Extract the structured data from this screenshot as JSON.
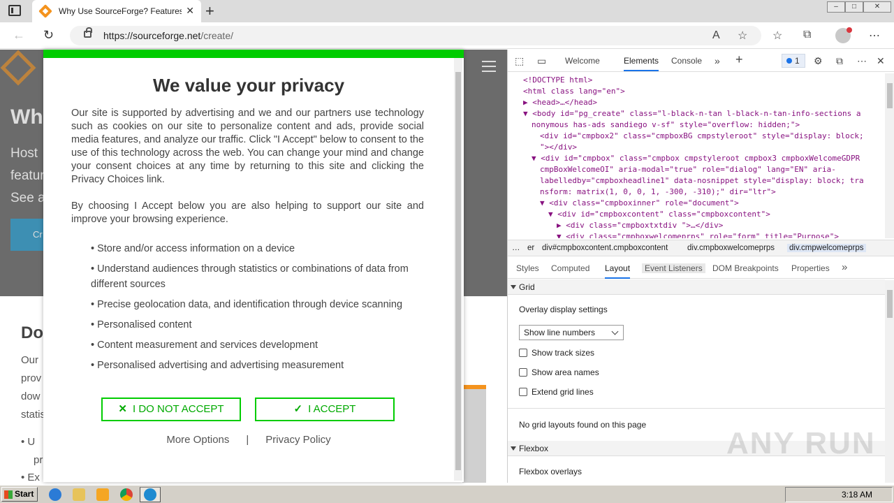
{
  "browser": {
    "tab_title": "Why Use SourceForge? Features a",
    "tab_close": "✕",
    "new_tab": "+",
    "url_host": "https://sourceforge.net",
    "url_path": "/create/"
  },
  "page_behind": {
    "hero_heading": "Wh",
    "hero_lines": [
      "Host",
      "featur",
      "See a"
    ],
    "hero_button": "Cr",
    "doc_heading": "Do",
    "doc_lines": [
      "Our",
      "prov",
      "dow",
      "statis"
    ],
    "doc_bullets": [
      "U",
      "pr",
      "Ex"
    ]
  },
  "consent": {
    "title": "We value your privacy",
    "intro": "Our site is supported by advertising and we and our partners use technology such as cookies on our site to personalize content and ads, provide social media features, and analyze our traffic. Click \"I Accept\" below to consent to the use of this technology across the web. You can change your mind and change your consent choices at any time by returning to this site and clicking the Privacy Choices link.",
    "choosing": "By choosing I Accept below you are also helping to support our site and improve your browsing experience.",
    "purposes": [
      "• Store and/or access information on a device",
      "• Understand audiences through statistics or combinations of data from different sources",
      "• Precise geolocation data, and identification through device scanning",
      "• Personalised content",
      "• Content measurement and services development",
      "• Personalised advertising and advertising measurement"
    ],
    "reject_label": "I DO NOT ACCEPT",
    "accept_label": "I ACCEPT",
    "more_options": "More Options",
    "separator": "|",
    "privacy_policy": "Privacy Policy"
  },
  "devtools": {
    "tabs": [
      "Welcome",
      "Elements",
      "Console"
    ],
    "active_tab": "Elements",
    "issues_count": "1",
    "dom_lines": [
      {
        "indent": 0,
        "arrow": "",
        "html": "<!DOCTYPE html>"
      },
      {
        "indent": 0,
        "arrow": "",
        "html": "<html class lang=\"en\">"
      },
      {
        "indent": 1,
        "arrow": "▶",
        "html": "<head>…</head>"
      },
      {
        "indent": 1,
        "arrow": "▼",
        "html": "<body id=\"pg_create\" class=\"l-black-n-tan l-black-n-tan-info-sections  a"
      },
      {
        "indent": 1,
        "arrow": "",
        "html": "nonymous has-ads sandiego v-sf\" style=\"overflow: hidden;\">"
      },
      {
        "indent": 2,
        "arrow": "",
        "html": "<div id=\"cmpbox2\" class=\"cmpboxBG cmpstyleroot\" style=\"display: block;"
      },
      {
        "indent": 2,
        "arrow": "",
        "html": "\"></div>"
      },
      {
        "indent": 2,
        "arrow": "▼",
        "html": "<div id=\"cmpbox\" class=\"cmpbox cmpstyleroot cmpbox3 cmpboxWelcomeGDPR"
      },
      {
        "indent": 2,
        "arrow": "",
        "html": "cmpBoxWelcomeOI\" aria-modal=\"true\" role=\"dialog\" lang=\"EN\" aria-"
      },
      {
        "indent": 2,
        "arrow": "",
        "html": "labelledby=\"cmpboxheadline1\" data-nosnippet style=\"display: block; tra"
      },
      {
        "indent": 2,
        "arrow": "",
        "html": "nsform: matrix(1, 0, 0, 1, -300, -310);\" dir=\"ltr\">"
      },
      {
        "indent": 3,
        "arrow": "▼",
        "html": "<div class=\"cmpboxinner\" role=\"document\">"
      },
      {
        "indent": 4,
        "arrow": "▼",
        "html": "<div id=\"cmpboxcontent\" class=\"cmpboxcontent\">"
      },
      {
        "indent": 5,
        "arrow": "▶",
        "html": "<div class=\"cmpboxtxtdiv \">…</div>"
      },
      {
        "indent": 5,
        "arrow": "▼",
        "html": "<div class=\"cmpboxwelcomeprps\" role=\"form\" title=\"Purpose\">"
      }
    ],
    "breadcrumbs": [
      "…",
      "er",
      "div#cmpboxcontent.cmpboxcontent",
      "div.cmpboxwelcomeprps",
      "div.cmpwelcomeprps"
    ],
    "sub_tabs": [
      "Styles",
      "Computed",
      "Layout",
      "Event Listeners",
      "DOM Breakpoints",
      "Properties"
    ],
    "active_sub_tab": "Layout",
    "grid_section": "Grid",
    "overlay_settings": "Overlay display settings",
    "select_value": "Show line numbers",
    "checkboxes": [
      "Show track sizes",
      "Show area names",
      "Extend grid lines"
    ],
    "no_grid": "No grid layouts found on this page",
    "flexbox_section": "Flexbox",
    "flexbox_overlays": "Flexbox overlays"
  },
  "watermark": "ANY RUN",
  "taskbar": {
    "start": "Start",
    "clock": "3:18 AM"
  },
  "colors": {
    "consent_green": "#00cc00",
    "brand_orange": "#f4931e",
    "devtools_accent": "#1a73e8"
  }
}
